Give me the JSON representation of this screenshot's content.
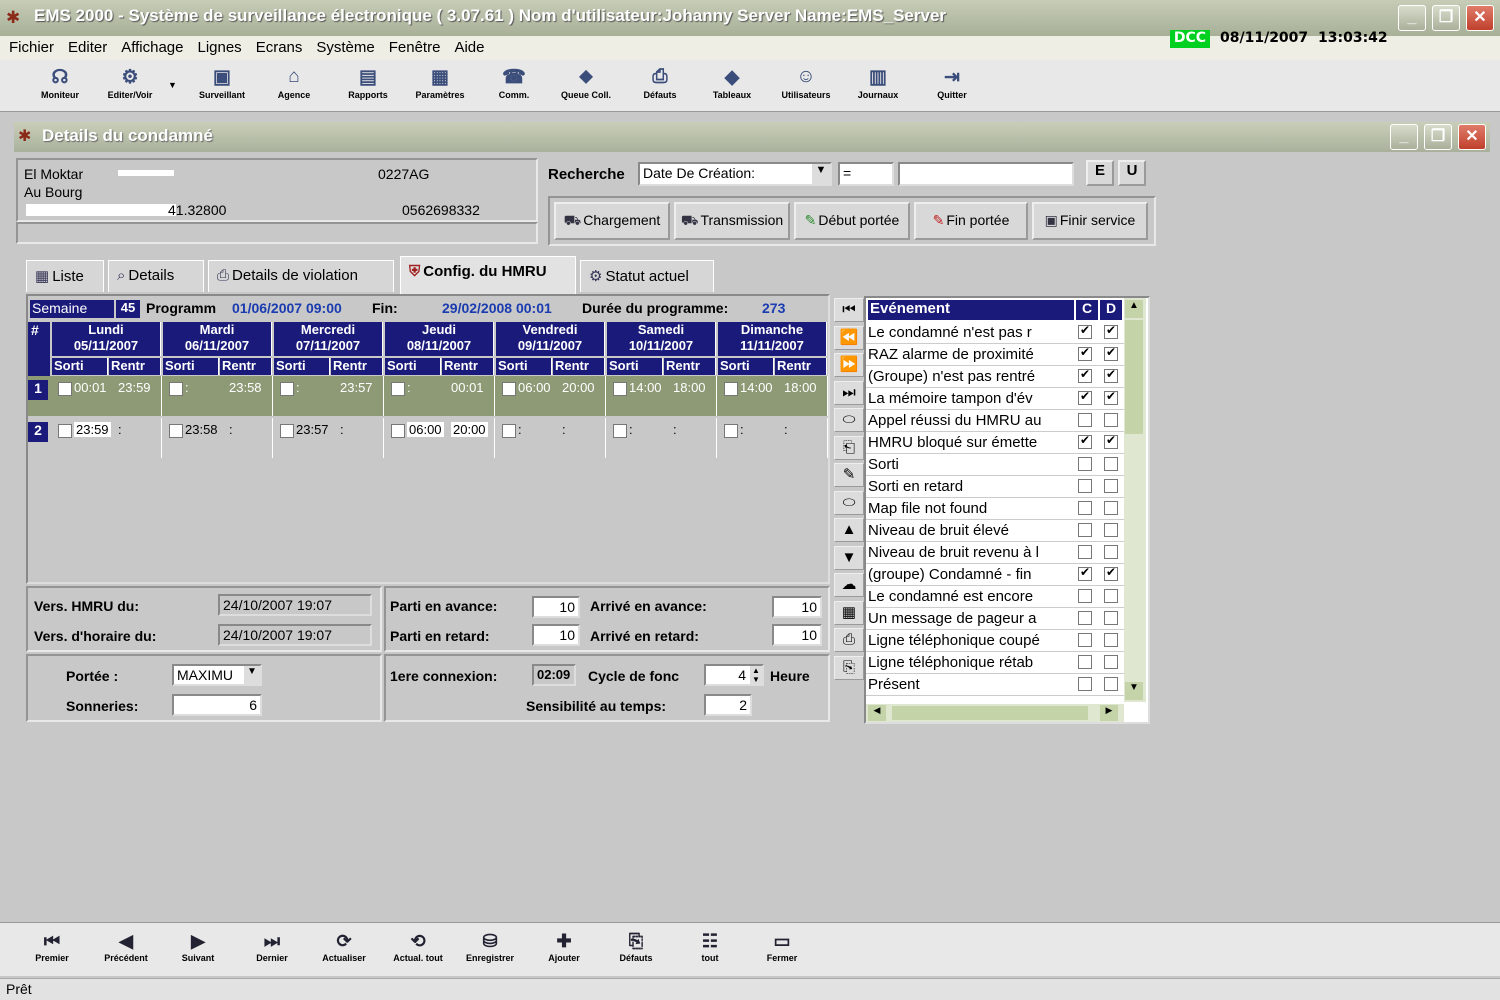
{
  "window": {
    "title": "EMS 2000 - Système de surveillance électronique ( 3.07.61 )  Nom d'utilisateur:Johanny  Server Name:EMS_Server"
  },
  "menu": [
    "Fichier",
    "Editer",
    "Affichage",
    "Lignes",
    "Ecrans",
    "Système",
    "Fenêtre",
    "Aide"
  ],
  "status": {
    "dcc": "DCC",
    "date": "08/11/2007",
    "time": "13:03:42"
  },
  "toolbar": [
    {
      "label": "Moniteur",
      "icon": "monitor-icon",
      "glyph": "☊"
    },
    {
      "label": "Editer/Voir",
      "icon": "edit-icon",
      "glyph": "⚙"
    },
    {
      "label": "Surveillant",
      "icon": "supervisor-icon",
      "glyph": "▣"
    },
    {
      "label": "Agence",
      "icon": "agency-icon",
      "glyph": "⌂"
    },
    {
      "label": "Rapports",
      "icon": "reports-icon",
      "glyph": "▤"
    },
    {
      "label": "Paramètres",
      "icon": "parameters-icon",
      "glyph": "▦"
    },
    {
      "label": "Comm.",
      "icon": "comm-icon",
      "glyph": "☎"
    },
    {
      "label": "Queue Coll.",
      "icon": "queue-icon",
      "glyph": "⬥"
    },
    {
      "label": "Défauts",
      "icon": "defaults-icon",
      "glyph": "⎙"
    },
    {
      "label": "Tableaux",
      "icon": "tables-icon",
      "glyph": "◆"
    },
    {
      "label": "Utilisateurs",
      "icon": "users-icon",
      "glyph": "☺"
    },
    {
      "label": "Journaux",
      "icon": "journals-icon",
      "glyph": "▥"
    },
    {
      "label": "Quitter",
      "icon": "exit-icon",
      "glyph": "⇥"
    }
  ],
  "sub_window": {
    "title": "Details du condamné"
  },
  "offender": {
    "name": "El Moktar",
    "id": "0227AG",
    "address": "Au Bourg",
    "postal": "41.32800",
    "phone": "0562698332"
  },
  "search": {
    "label": "Recherche",
    "field": "Date De Création:",
    "op": "=",
    "value": "",
    "btn_e": "E",
    "btn_u": "U"
  },
  "actions": [
    "Chargement",
    "Transmission",
    "Début portée",
    "Fin portée",
    "Finir service"
  ],
  "tabs": [
    {
      "label": "Liste",
      "icon": "list-icon"
    },
    {
      "label": "Details",
      "icon": "details-icon"
    },
    {
      "label": "Details de violation",
      "icon": "violation-icon"
    },
    {
      "label": "Config. du HMRU",
      "icon": "hmru-icon",
      "active": true
    },
    {
      "label": "Statut actuel",
      "icon": "status-icon"
    }
  ],
  "schedule": {
    "semaine_label": "Semaine",
    "semaine_val": "45",
    "programme_label": "Programm",
    "programme_val": "01/06/2007 09:00",
    "fin_label": "Fin:",
    "fin_val": "29/02/2008 00:01",
    "duree_label": "Durée du programme:",
    "duree_val": "273",
    "hash": "#",
    "days": [
      {
        "name": "Lundi",
        "date": "05/11/2007"
      },
      {
        "name": "Mardi",
        "date": "06/11/2007"
      },
      {
        "name": "Mercredi",
        "date": "07/11/2007"
      },
      {
        "name": "Jeudi",
        "date": "08/11/2007"
      },
      {
        "name": "Vendredi",
        "date": "09/11/2007"
      },
      {
        "name": "Samedi",
        "date": "10/11/2007"
      },
      {
        "name": "Dimanche",
        "date": "11/11/2007"
      }
    ],
    "sorti": "Sorti",
    "rentre": "Rentr",
    "rows": [
      {
        "num": "1",
        "cells": [
          [
            "00:01",
            "23:59"
          ],
          [
            ":",
            "23:58"
          ],
          [
            ":",
            "23:57"
          ],
          [
            ":",
            "00:01"
          ],
          [
            "06:00",
            "20:00"
          ],
          [
            "14:00",
            "18:00"
          ],
          [
            "14:00",
            "18:00"
          ]
        ]
      },
      {
        "num": "2",
        "cells": [
          [
            "23:59",
            ":"
          ],
          [
            "23:58",
            ":"
          ],
          [
            "23:57",
            ":"
          ],
          [
            "06:00",
            "20:00"
          ],
          [
            ":",
            ":"
          ],
          [
            ":",
            ":"
          ],
          [
            ":",
            ":"
          ]
        ]
      }
    ]
  },
  "config": {
    "vers_hmru_label": "Vers. HMRU du:",
    "vers_hmru": "24/10/2007 19:07",
    "vers_horaire_label": "Vers. d'horaire du:",
    "vers_horaire": "24/10/2007 19:07",
    "parti_avance_label": "Parti en avance:",
    "parti_avance": "10",
    "arrive_avance_label": "Arrivé en avance:",
    "arrive_avance": "10",
    "parti_retard_label": "Parti en retard:",
    "parti_retard": "10",
    "arrive_retard_label": "Arrivé en retard:",
    "arrive_retard": "10",
    "portee_label": "Portée :",
    "portee": "MAXIMU",
    "sonneries_label": "Sonneries:",
    "sonneries": "6",
    "connexion_label": "1ere connexion:",
    "connexion": "02:09",
    "cycle_label": "Cycle de fonc",
    "cycle": "4",
    "heure": "Heure",
    "sensibilite_label": "Sensibilité au temps:",
    "sensibilite": "2"
  },
  "events": {
    "header": "Evénement",
    "col_c": "C",
    "col_d": "D",
    "items": [
      {
        "text": "Le condamné n'est pas r",
        "c": true,
        "d": true
      },
      {
        "text": "RAZ alarme de proximité",
        "c": true,
        "d": true
      },
      {
        "text": "(Groupe) n'est pas rentré",
        "c": true,
        "d": true
      },
      {
        "text": "La mémoire tampon d'év",
        "c": true,
        "d": true
      },
      {
        "text": "Appel réussi du HMRU au",
        "c": false,
        "d": false
      },
      {
        "text": "HMRU bloqué sur émette",
        "c": true,
        "d": true
      },
      {
        "text": "Sorti",
        "c": false,
        "d": false
      },
      {
        "text": "Sorti en retard",
        "c": false,
        "d": false
      },
      {
        "text": "Map file not found",
        "c": false,
        "d": false
      },
      {
        "text": "Niveau de bruit élevé",
        "c": false,
        "d": false
      },
      {
        "text": "Niveau de bruit revenu à l",
        "c": false,
        "d": false
      },
      {
        "text": "(groupe) Condamné - fin",
        "c": true,
        "d": true
      },
      {
        "text": "Le condamné est encore",
        "c": false,
        "d": false
      },
      {
        "text": "Un message de pageur a",
        "c": false,
        "d": false
      },
      {
        "text": "Ligne téléphonique coupé",
        "c": false,
        "d": false
      },
      {
        "text": "Ligne téléphonique rétab",
        "c": false,
        "d": false
      },
      {
        "text": "Présent",
        "c": false,
        "d": false
      }
    ]
  },
  "bottom_toolbar": [
    {
      "label": "Premier",
      "icon": "first-icon",
      "glyph": "⏮"
    },
    {
      "label": "Précédent",
      "icon": "previous-icon",
      "glyph": "◀"
    },
    {
      "label": "Suivant",
      "icon": "next-icon",
      "glyph": "▶"
    },
    {
      "label": "Dernier",
      "icon": "last-icon",
      "glyph": "⏭"
    },
    {
      "label": "Actualiser",
      "icon": "refresh-icon",
      "glyph": "⟳"
    },
    {
      "label": "Actual. tout",
      "icon": "refresh-all-icon",
      "glyph": "⟲"
    },
    {
      "label": "Enregistrer",
      "icon": "save-icon",
      "glyph": "⛁"
    },
    {
      "label": "Ajouter",
      "icon": "add-icon",
      "glyph": "✚"
    },
    {
      "label": "Défauts",
      "icon": "defaults-icon",
      "glyph": "⎘"
    },
    {
      "label": "tout",
      "icon": "all-icon",
      "glyph": "☷"
    },
    {
      "label": "Fermer",
      "icon": "close-folder-icon",
      "glyph": "▭"
    }
  ],
  "statusbar": "Prêt"
}
